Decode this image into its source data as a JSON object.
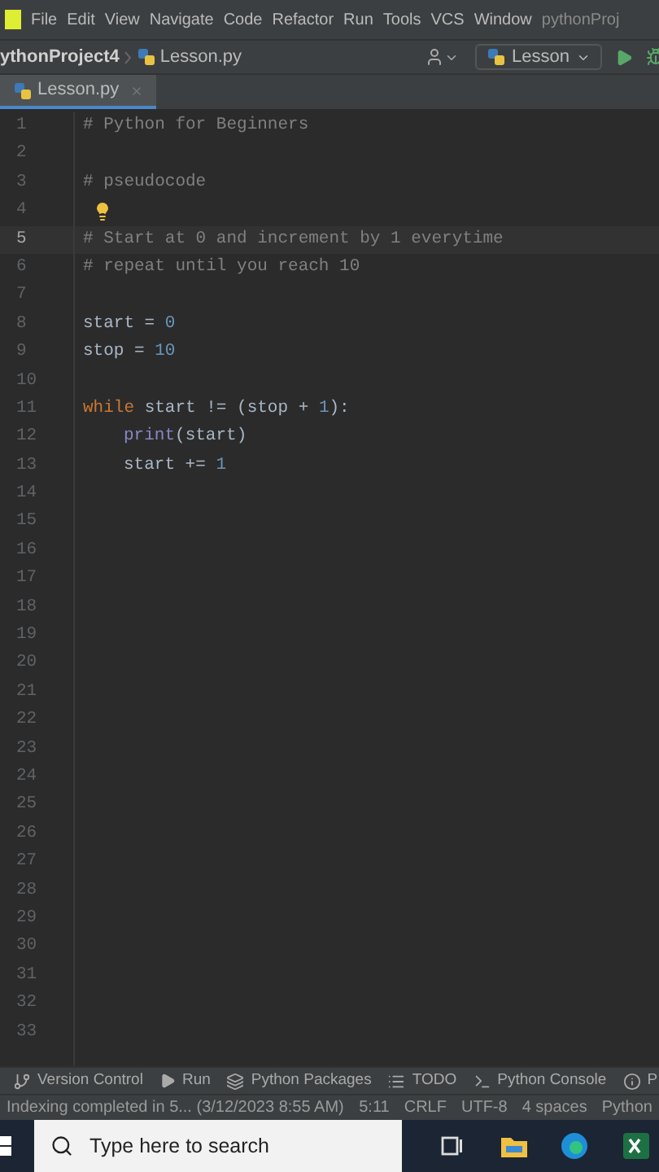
{
  "menu": [
    "File",
    "Edit",
    "View",
    "Navigate",
    "Code",
    "Refactor",
    "Run",
    "Tools",
    "VCS",
    "Window"
  ],
  "window_title": "pythonProj",
  "breadcrumb": [
    "ythonProject4",
    "Lesson.py"
  ],
  "run_config": "Lesson",
  "tabs": [
    {
      "label": "Lesson.py",
      "selected": true
    }
  ],
  "editor": {
    "lines": [
      {
        "number": "1",
        "current": false,
        "tokens": [
          {
            "kind": "comment",
            "text": "# Python for Beginners"
          }
        ]
      },
      {
        "number": "2",
        "current": false
      },
      {
        "number": "3",
        "current": false,
        "tokens": [
          {
            "kind": "comment",
            "text": "# pseudocode"
          }
        ]
      },
      {
        "number": "4",
        "current": false,
        "hint": true
      },
      {
        "number": "5",
        "current": true,
        "tokens": [
          {
            "kind": "comment",
            "text": "# Start at 0 and increment by 1 everytime"
          }
        ]
      },
      {
        "number": "6",
        "current": false,
        "tokens": [
          {
            "kind": "comment",
            "text": "# repeat until you reach 10"
          }
        ]
      },
      {
        "number": "7",
        "current": false
      },
      {
        "number": "8",
        "current": false,
        "tokens": [
          {
            "kind": "plain",
            "text": "start = "
          },
          {
            "kind": "number",
            "text": "0"
          }
        ]
      },
      {
        "number": "9",
        "current": false,
        "tokens": [
          {
            "kind": "plain",
            "text": "stop = "
          },
          {
            "kind": "number",
            "text": "10"
          }
        ]
      },
      {
        "number": "10",
        "current": false
      },
      {
        "number": "11",
        "current": false,
        "tokens": [
          {
            "kind": "keyword",
            "text": "while "
          },
          {
            "kind": "plain",
            "text": "start != (stop + "
          },
          {
            "kind": "number",
            "text": "1"
          },
          {
            "kind": "plain",
            "text": "):"
          }
        ]
      },
      {
        "number": "12",
        "current": false,
        "indented": true,
        "tokens": [
          {
            "kind": "builtin",
            "text": "print"
          },
          {
            "kind": "plain",
            "text": "(start)"
          }
        ]
      },
      {
        "number": "13",
        "current": false,
        "indented": true,
        "tokens": [
          {
            "kind": "plain",
            "text": "start += "
          },
          {
            "kind": "number",
            "text": "1"
          }
        ]
      },
      {
        "number": "14",
        "current": false
      },
      {
        "number": "15",
        "current": false
      },
      {
        "number": "16",
        "current": false
      },
      {
        "number": "17",
        "current": false
      },
      {
        "number": "18",
        "current": false
      },
      {
        "number": "19",
        "current": false
      },
      {
        "number": "20",
        "current": false
      },
      {
        "number": "21",
        "current": false
      },
      {
        "number": "22",
        "current": false
      },
      {
        "number": "23",
        "current": false
      },
      {
        "number": "24",
        "current": false
      },
      {
        "number": "25",
        "current": false
      },
      {
        "number": "26",
        "current": false
      },
      {
        "number": "27",
        "current": false
      },
      {
        "number": "28",
        "current": false
      },
      {
        "number": "29",
        "current": false
      },
      {
        "number": "30",
        "current": false
      },
      {
        "number": "31",
        "current": false
      },
      {
        "number": "32",
        "current": false
      },
      {
        "number": "33",
        "current": false
      }
    ]
  },
  "tool_windows": [
    {
      "kind": "vcs",
      "label": "Version Control"
    },
    {
      "kind": "run",
      "label": "Run"
    },
    {
      "kind": "packages",
      "label": "Python Packages"
    },
    {
      "kind": "todo",
      "label": "TODO"
    },
    {
      "kind": "console",
      "label": "Python Console"
    },
    {
      "kind": "problems",
      "label": "P"
    }
  ],
  "status_bar": {
    "message": "Indexing completed in 5... (3/12/2023 8:55 AM)",
    "items": [
      "5:11",
      "CRLF",
      "UTF-8",
      "4 spaces",
      "Python"
    ]
  },
  "taskbar": {
    "search_placeholder": "Type here to search"
  }
}
